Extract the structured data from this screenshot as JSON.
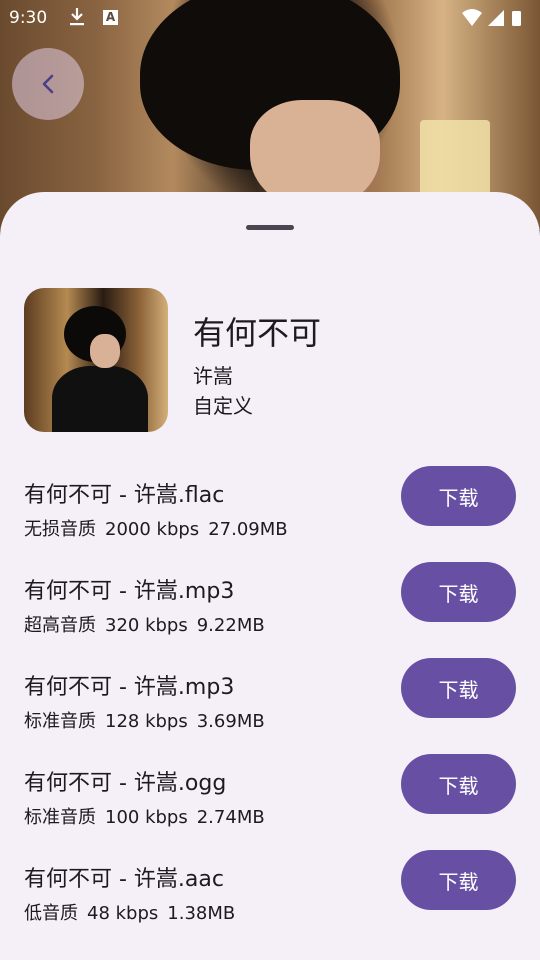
{
  "status_bar": {
    "time": "9:30",
    "icons": [
      "download-icon",
      "a-letter-icon",
      "wifi-icon",
      "signal-icon",
      "battery-icon"
    ],
    "a_letter": "A"
  },
  "header": {
    "back_icon": "chevron-left-icon"
  },
  "song": {
    "title": "有何不可",
    "artist": "许嵩",
    "source": "自定义"
  },
  "files": [
    {
      "name": "有何不可 - 许嵩.flac",
      "quality": "无损音质",
      "bitrate": "2000 kbps",
      "size": "27.09MB",
      "button": "下载"
    },
    {
      "name": "有何不可 - 许嵩.mp3",
      "quality": "超高音质",
      "bitrate": "320 kbps",
      "size": "9.22MB",
      "button": "下载"
    },
    {
      "name": "有何不可 - 许嵩.mp3",
      "quality": "标准音质",
      "bitrate": "128 kbps",
      "size": "3.69MB",
      "button": "下载"
    },
    {
      "name": "有何不可 - 许嵩.ogg",
      "quality": "标准音质",
      "bitrate": "100 kbps",
      "size": "2.74MB",
      "button": "下载"
    },
    {
      "name": "有何不可 - 许嵩.aac",
      "quality": "低音质",
      "bitrate": "48 kbps",
      "size": "1.38MB",
      "button": "下载"
    }
  ],
  "colors": {
    "sheet_bg": "#f5eff7",
    "accent": "#6750a4",
    "text": "#1d1b20"
  }
}
